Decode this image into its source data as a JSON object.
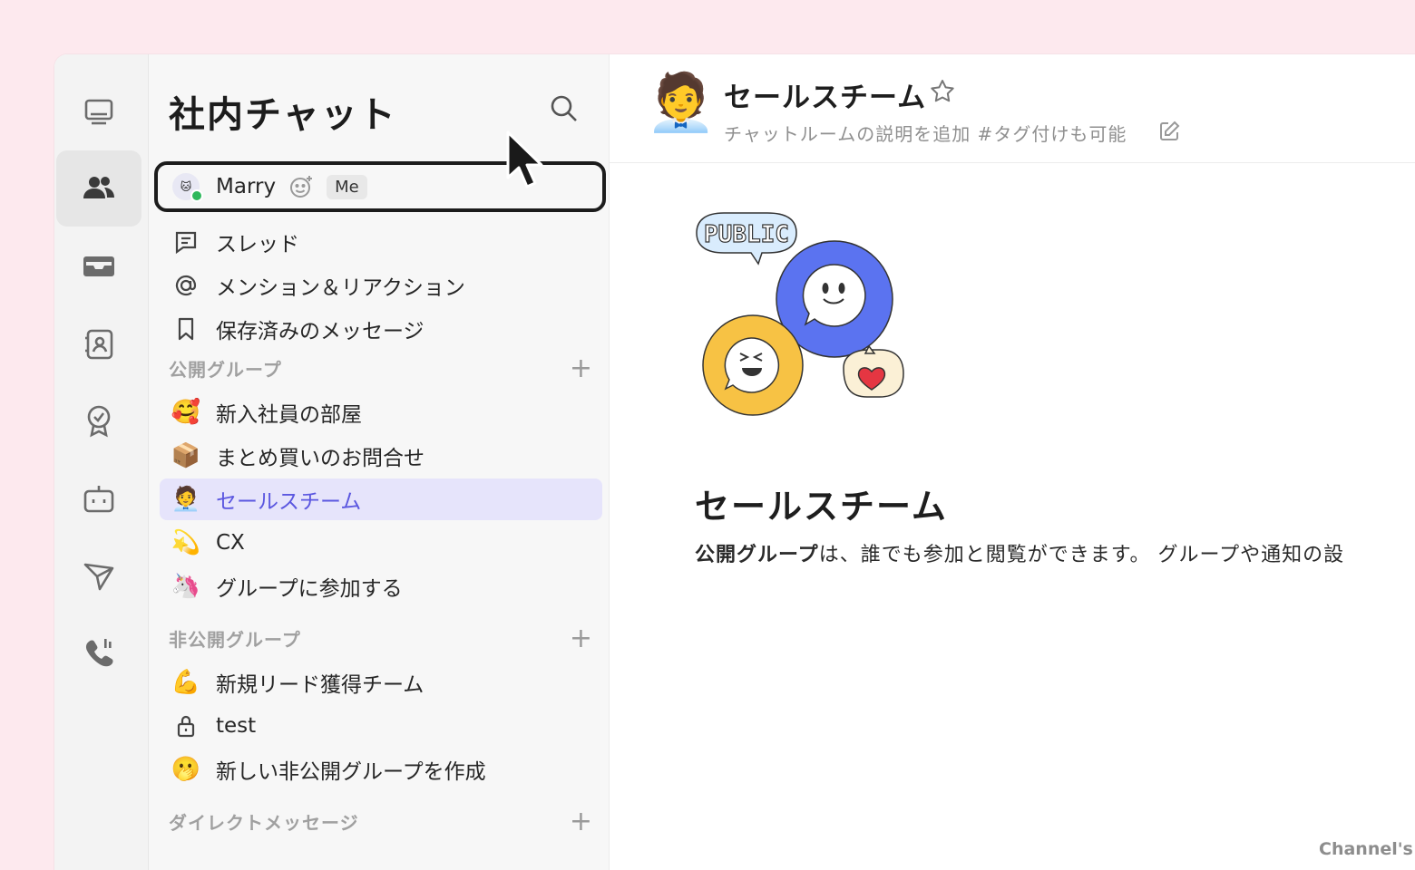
{
  "colors": {
    "page_bg": "#fde9ee",
    "accent": "#5b57e0",
    "active_row_bg": "#e6e4fb",
    "online": "#2eb85c"
  },
  "rail": {
    "items": [
      {
        "icon": "monitor-icon"
      },
      {
        "icon": "people-icon",
        "active": true
      },
      {
        "icon": "inbox-icon"
      },
      {
        "icon": "contact-card-icon"
      },
      {
        "icon": "award-icon"
      },
      {
        "icon": "bot-icon"
      },
      {
        "icon": "send-icon"
      },
      {
        "icon": "phone-icon"
      }
    ]
  },
  "sidebar": {
    "title": "社内チャット",
    "me": {
      "name": "Marry",
      "badge": "Me"
    },
    "nav": [
      {
        "label": "スレッド",
        "icon": "thread-icon"
      },
      {
        "label": "メンション＆リアクション",
        "icon": "at-icon"
      },
      {
        "label": "保存済みのメッセージ",
        "icon": "bookmark-icon"
      }
    ],
    "public_header": "公開グループ",
    "public_groups": [
      {
        "emoji": "🥰",
        "label": "新入社員の部屋"
      },
      {
        "emoji": "📦",
        "label": "まとめ買いのお問合せ"
      },
      {
        "emoji": "🧑‍💼",
        "label": "セールスチーム",
        "active": true
      },
      {
        "emoji": "💫",
        "label": "CX"
      },
      {
        "emoji": "🦄",
        "label": "グループに参加する"
      }
    ],
    "private_header": "非公開グループ",
    "private_groups": [
      {
        "emoji": "💪",
        "label": "新規リード獲得チーム"
      },
      {
        "emoji": "🔒",
        "label": "test"
      },
      {
        "emoji": "🫢",
        "label": "新しい非公開グループを作成"
      }
    ],
    "dm_header": "ダイレクトメッセージ"
  },
  "channel": {
    "emoji": "🧑‍💼",
    "title": "セールスチーム",
    "description": "チャットルームの説明を追加 #タグ付けも可能",
    "illustration_label": "PUBLIC",
    "welcome_title": "セールスチーム",
    "welcome_desc_bold": "公開グループ",
    "welcome_desc_rest": "は、誰でも参加と閲覧ができます。 グループや通知の設",
    "footer_note": "Channel's"
  }
}
